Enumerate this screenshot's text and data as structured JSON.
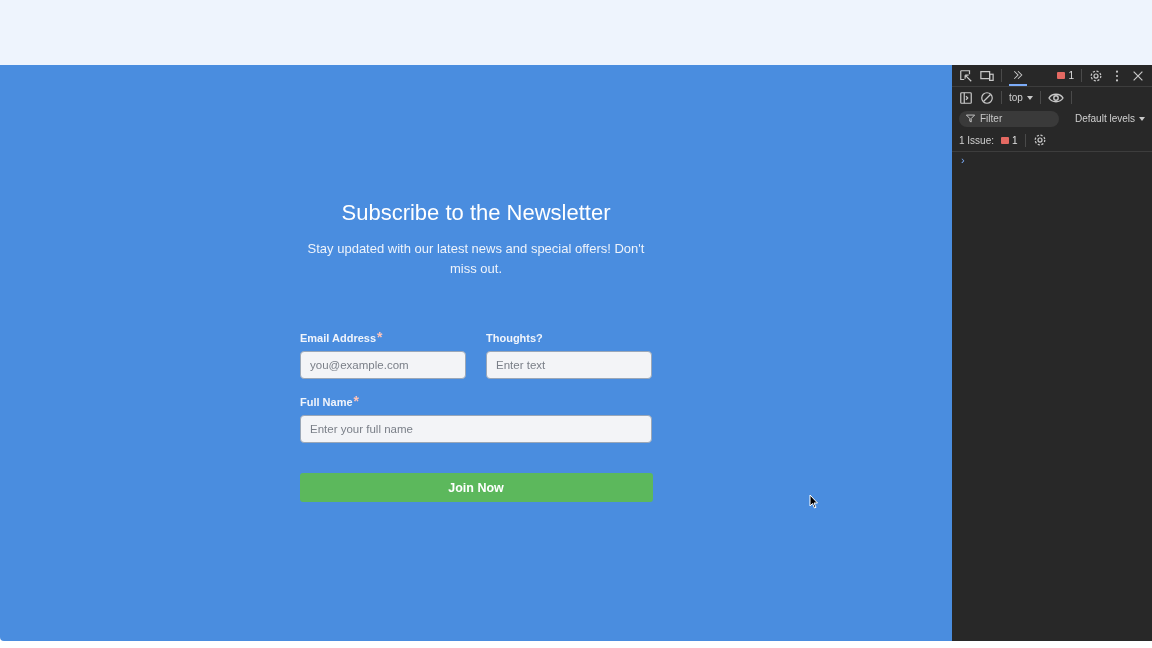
{
  "form": {
    "title": "Subscribe to the Newsletter",
    "subtitle": "Stay updated with our latest news and special offers! Don't miss out.",
    "fields": [
      {
        "label": "Email Address",
        "required_mark": "*",
        "placeholder": "you@example.com",
        "wide": false
      },
      {
        "label": "Thoughts?",
        "placeholder": "Enter text",
        "wide": false
      },
      {
        "label": "Full Name",
        "required_mark": "*",
        "placeholder": "Enter your full name",
        "wide": true
      }
    ],
    "submit": "Join Now"
  },
  "devtools": {
    "issue_badge": "1",
    "context": "top",
    "filter_placeholder": "Filter",
    "levels": "Default levels",
    "issues_label": "1 Issue:",
    "issues_count": "1",
    "prompt": "›"
  }
}
